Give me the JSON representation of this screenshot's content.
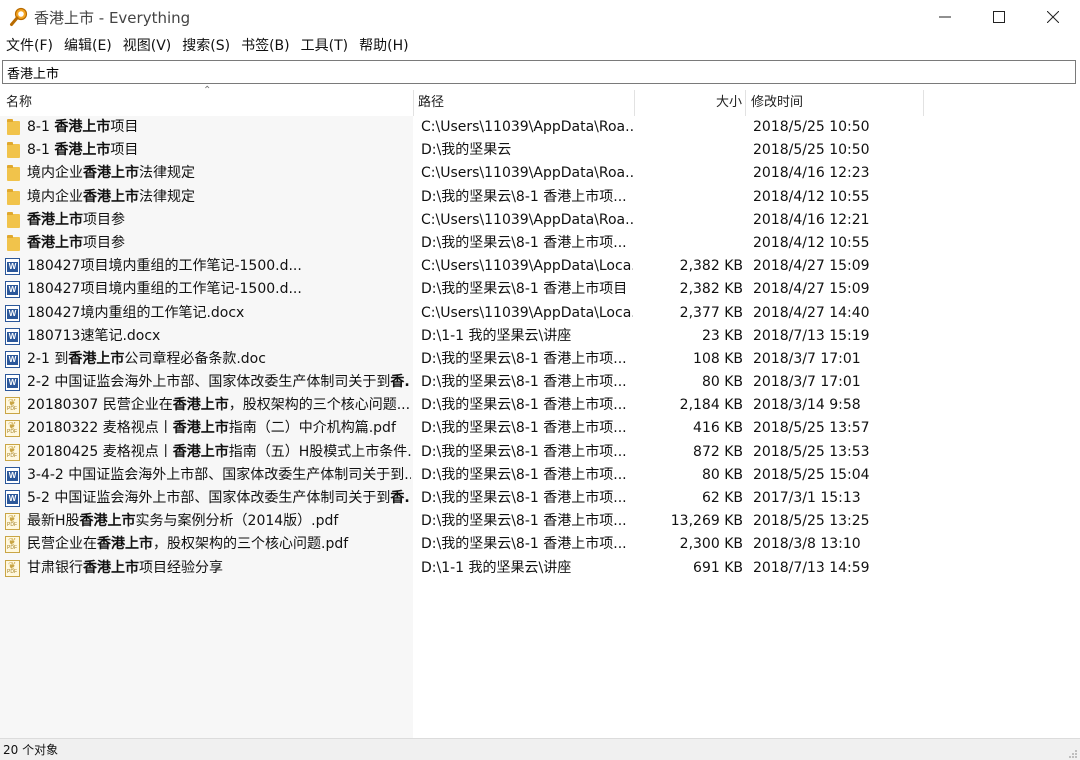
{
  "window": {
    "title": "香港上市 - Everything",
    "search_value": "香港上市"
  },
  "menu": [
    "文件(F)",
    "编辑(E)",
    "视图(V)",
    "搜索(S)",
    "书签(B)",
    "工具(T)",
    "帮助(H)"
  ],
  "columns": {
    "name": "名称",
    "path": "路径",
    "size": "大小",
    "date": "修改时间"
  },
  "rows": [
    {
      "icon": "folder",
      "pre": "8-1 ",
      "bold": "香港上市",
      "post": "项目",
      "path": "C:\\Users\\11039\\AppData\\Roa...",
      "size": "",
      "date": "2018/5/25 10:50"
    },
    {
      "icon": "folder",
      "pre": "8-1 ",
      "bold": "香港上市",
      "post": "项目",
      "path": "D:\\我的坚果云",
      "size": "",
      "date": "2018/5/25 10:50"
    },
    {
      "icon": "folder",
      "pre": "境内企业",
      "bold": "香港上市",
      "post": "法律规定",
      "path": "C:\\Users\\11039\\AppData\\Roa...",
      "size": "",
      "date": "2018/4/16 12:23"
    },
    {
      "icon": "folder",
      "pre": "境内企业",
      "bold": "香港上市",
      "post": "法律规定",
      "path": "D:\\我的坚果云\\8-1 香港上市项...",
      "size": "",
      "date": "2018/4/12 10:55"
    },
    {
      "icon": "folder",
      "pre": "",
      "bold": "香港上市",
      "post": "项目参",
      "path": "C:\\Users\\11039\\AppData\\Roa...",
      "size": "",
      "date": "2018/4/16 12:21"
    },
    {
      "icon": "folder",
      "pre": "",
      "bold": "香港上市",
      "post": "项目参",
      "path": "D:\\我的坚果云\\8-1 香港上市项...",
      "size": "",
      "date": "2018/4/12 10:55"
    },
    {
      "icon": "word",
      "pre": "180427",
      "bold": "",
      "post": "项目境内重组的工作笔记-1500.d...",
      "path": "C:\\Users\\11039\\AppData\\Loca...",
      "size": "2,382 KB",
      "date": "2018/4/27 15:09"
    },
    {
      "icon": "word",
      "pre": "180427",
      "bold": "",
      "post": "项目境内重组的工作笔记-1500.d...",
      "path": "D:\\我的坚果云\\8-1 香港上市项目",
      "size": "2,382 KB",
      "date": "2018/4/27 15:09"
    },
    {
      "icon": "word",
      "pre": "180427",
      "bold": "",
      "post": "境内重组的工作笔记.docx",
      "path": "C:\\Users\\11039\\AppData\\Loca...",
      "size": "2,377 KB",
      "date": "2018/4/27 14:40"
    },
    {
      "icon": "word",
      "pre": "180713",
      "bold": "",
      "post": "速笔记.docx",
      "path": "D:\\1-1 我的坚果云\\讲座",
      "size": "23 KB",
      "date": "2018/7/13 15:19"
    },
    {
      "icon": "word",
      "pre": "2-1 到",
      "bold": "香港上市",
      "post": "公司章程必备条款.doc",
      "path": "D:\\我的坚果云\\8-1 香港上市项...",
      "size": "108 KB",
      "date": "2018/3/7 17:01"
    },
    {
      "icon": "word",
      "pre": "2-2 中国证监会海外上市部、国家体改委生产体制司关于到",
      "bold": "香...",
      "post": "",
      "path": "D:\\我的坚果云\\8-1 香港上市项...",
      "size": "80 KB",
      "date": "2018/3/7 17:01"
    },
    {
      "icon": "pdf",
      "pre": "20180307 民营企业在",
      "bold": "香港上市",
      "post": "，股权架构的三个核心问题....",
      "path": "D:\\我的坚果云\\8-1 香港上市项...",
      "size": "2,184 KB",
      "date": "2018/3/14 9:58"
    },
    {
      "icon": "pdf",
      "pre": "20180322 麦格视点丨",
      "bold": "香港上市",
      "post": "指南（二）中介机构篇.pdf",
      "path": "D:\\我的坚果云\\8-1 香港上市项...",
      "size": "416 KB",
      "date": "2018/5/25 13:57"
    },
    {
      "icon": "pdf",
      "pre": "20180425 麦格视点丨",
      "bold": "香港上市",
      "post": "指南（五）H股模式上市条件...",
      "path": "D:\\我的坚果云\\8-1 香港上市项...",
      "size": "872 KB",
      "date": "2018/5/25 13:53"
    },
    {
      "icon": "word",
      "pre": "3-4-2 中国证监会海外上市部、国家体改委生产体制司关于到...",
      "bold": "",
      "post": "",
      "path": "D:\\我的坚果云\\8-1 香港上市项...",
      "size": "80 KB",
      "date": "2018/5/25 15:04"
    },
    {
      "icon": "word",
      "pre": "5-2 中国证监会海外上市部、国家体改委生产体制司关于到",
      "bold": "香...",
      "post": "",
      "path": "D:\\我的坚果云\\8-1 香港上市项...",
      "size": "62 KB",
      "date": "2017/3/1 15:13"
    },
    {
      "icon": "pdf",
      "pre": "最新H股",
      "bold": "香港上市",
      "post": "实务与案例分析（2014版）.pdf",
      "path": "D:\\我的坚果云\\8-1 香港上市项...",
      "size": "13,269 KB",
      "date": "2018/5/25 13:25"
    },
    {
      "icon": "pdf",
      "pre": "民营企业在",
      "bold": "香港上市",
      "post": "，股权架构的三个核心问题.pdf",
      "path": "D:\\我的坚果云\\8-1 香港上市项...",
      "size": "2,300 KB",
      "date": "2018/3/8 13:10"
    },
    {
      "icon": "pdf",
      "pre": "甘肃银行",
      "bold": "香港上市",
      "post": "项目经验分享",
      "path": "D:\\1-1 我的坚果云\\讲座",
      "size": "691 KB",
      "date": "2018/7/13 14:59"
    }
  ],
  "status": "20 个对象",
  "colors": {
    "accent_folder": "#f1c34b",
    "word_blue": "#2b579a",
    "pdf_gold": "#c9a545"
  }
}
